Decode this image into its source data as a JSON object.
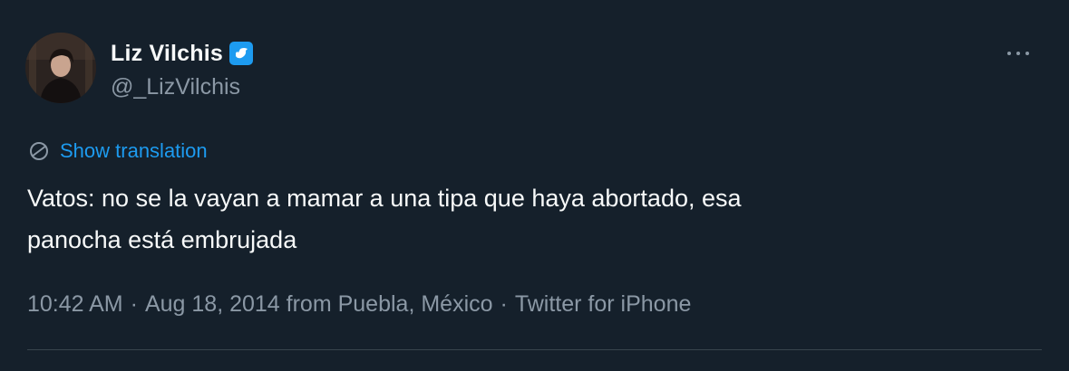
{
  "tweet": {
    "author": {
      "display_name": "Liz Vilchis",
      "handle": "@_LizVilchis",
      "verified_icon": "verified-badge-icon"
    },
    "more_icon": "more-options-icon",
    "translate": {
      "icon": "translate-globe-icon",
      "label": "Show translation"
    },
    "text": "Vatos: no se la vayan a mamar a una tipa que haya abortado, esa\npanocha está embrujada",
    "meta": {
      "time": "10:42 AM",
      "separator1": "·",
      "date_location": "Aug 18, 2014 from Puebla, México",
      "separator2": "·",
      "source": "Twitter for iPhone"
    }
  },
  "colors": {
    "background": "#15202b",
    "primary_text": "#f7f9f9",
    "secondary_text": "#8b98a5",
    "accent": "#1d9bf0",
    "divider": "#38444d"
  }
}
